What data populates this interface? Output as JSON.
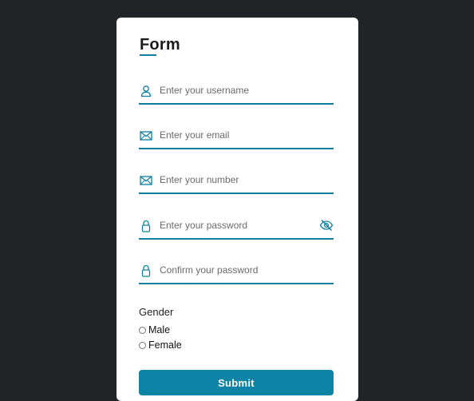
{
  "form": {
    "title": "Form",
    "fields": {
      "username": {
        "placeholder": "Enter your username",
        "value": "",
        "icon": "user-icon"
      },
      "email": {
        "placeholder": "Enter your email",
        "value": "",
        "icon": "envelope-icon"
      },
      "number": {
        "placeholder": "Enter your number",
        "value": "",
        "icon": "envelope-icon"
      },
      "password": {
        "placeholder": "Enter your password",
        "value": "",
        "icon": "lock-icon",
        "toggle_icon": "eye-slash-icon"
      },
      "confirm_password": {
        "placeholder": "Confirm your password",
        "value": "",
        "icon": "lock-icon"
      }
    },
    "gender": {
      "label": "Gender",
      "options": [
        "Male",
        "Female"
      ]
    },
    "submit_label": "Submit"
  },
  "colors": {
    "background": "#222428",
    "card": "#ffffff",
    "accent": "#0e7fa0",
    "button": "#0d84a5"
  }
}
